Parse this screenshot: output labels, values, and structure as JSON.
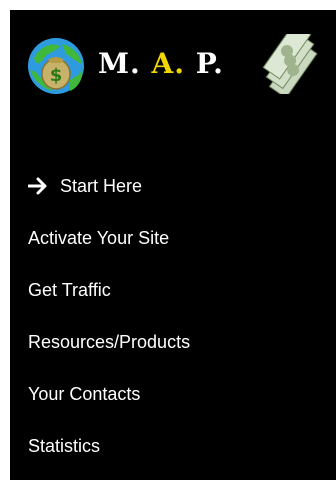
{
  "logo": {
    "part1": "M. ",
    "part2": "A.",
    "part3": " P.",
    "accent_color": "#f1d700",
    "icons": [
      "money-globe-icon",
      "dollar-bills-icon"
    ]
  },
  "nav": {
    "items": [
      {
        "label": "Start Here",
        "icon": "arrow-right-icon"
      },
      {
        "label": "Activate Your Site"
      },
      {
        "label": "Get Traffic"
      },
      {
        "label": "Resources/Products"
      },
      {
        "label": "Your Contacts"
      },
      {
        "label": "Statistics"
      }
    ]
  }
}
